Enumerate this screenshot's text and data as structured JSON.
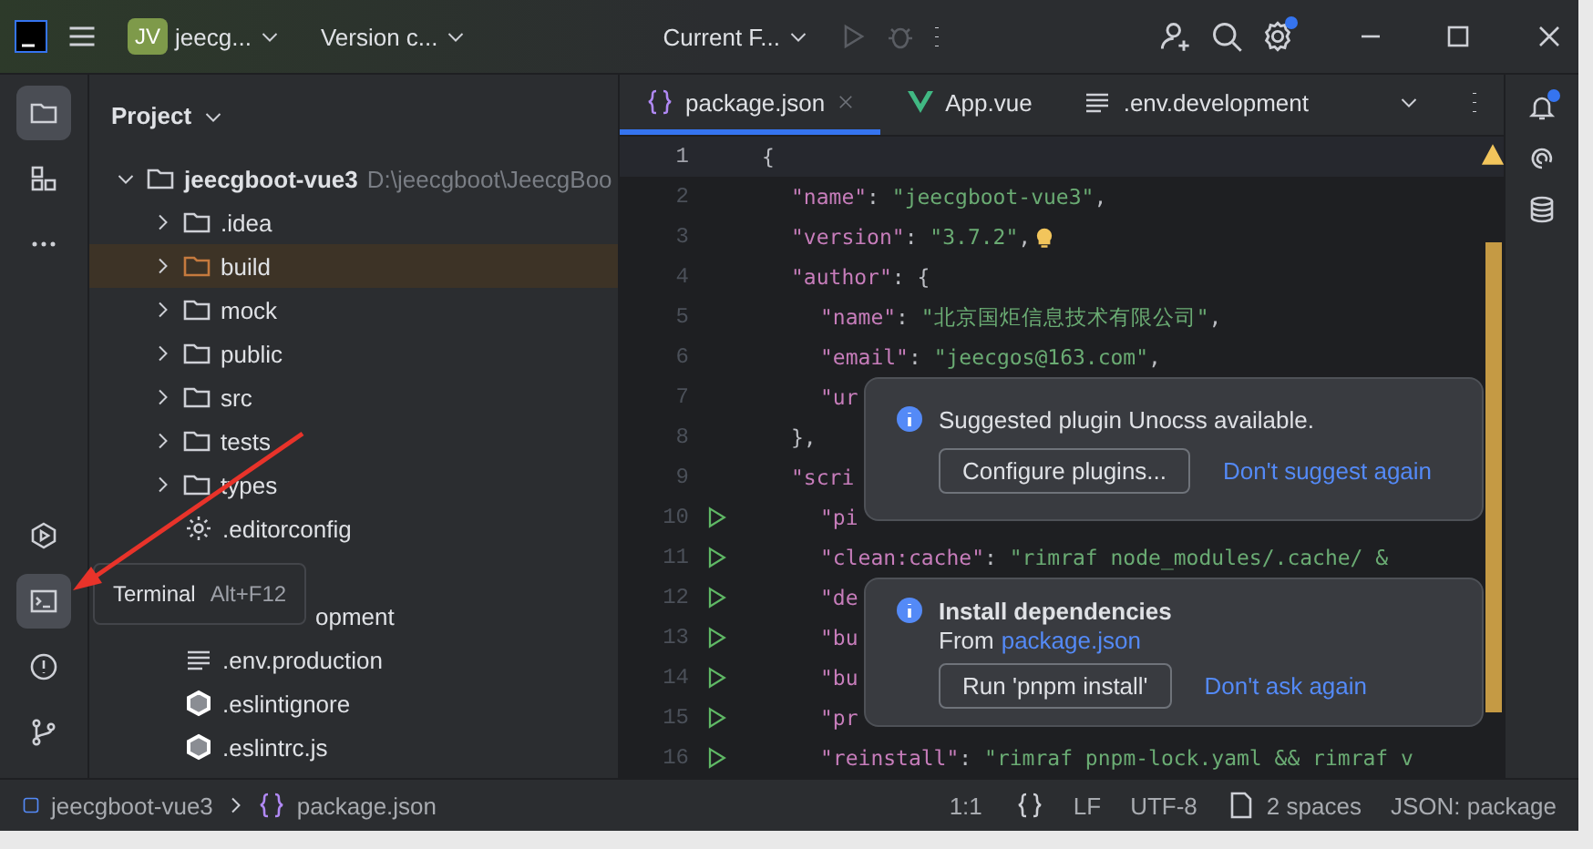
{
  "title_bar": {
    "avatar": "JV",
    "project": "jeecg...",
    "vcs": "Version c...",
    "run_config": "Current F...",
    "run_disabled": true,
    "settings_badge": true
  },
  "project_panel": {
    "title": "Project",
    "tree": {
      "name": "jeecgboot-vue3",
      "path": "D:\\jeecgboot\\JeecgBoo",
      "expanded": true,
      "children": [
        {
          "name": ".idea",
          "kind": "folder",
          "selected": false
        },
        {
          "name": "build",
          "kind": "folder",
          "selected": true
        },
        {
          "name": "mock",
          "kind": "folder",
          "selected": false
        },
        {
          "name": "public",
          "kind": "folder",
          "selected": false
        },
        {
          "name": "src",
          "kind": "folder",
          "selected": false
        },
        {
          "name": "tests",
          "kind": "folder",
          "selected": false
        },
        {
          "name": "types",
          "kind": "folder",
          "selected": false
        },
        {
          "name": ".editorconfig",
          "kind": "config",
          "selected": false
        },
        {
          "name": "opment",
          "kind": "partial",
          "selected": false
        },
        {
          "name": ".env.production",
          "kind": "text",
          "selected": false
        },
        {
          "name": ".eslintignore",
          "kind": "eslint",
          "selected": false
        },
        {
          "name": ".eslintrc.js",
          "kind": "eslint",
          "selected": false
        }
      ]
    }
  },
  "tool_strip": {
    "top": [
      {
        "kind": "folder",
        "selected": true
      },
      {
        "kind": "structure",
        "selected": false
      },
      {
        "kind": "more",
        "selected": false
      }
    ],
    "bottom": [
      {
        "kind": "run",
        "selected": false
      },
      {
        "kind": "terminal",
        "selected": true
      },
      {
        "kind": "problems",
        "selected": false
      },
      {
        "kind": "git",
        "selected": false
      }
    ]
  },
  "tooltip": {
    "label": "Terminal",
    "shortcut": "Alt+F12"
  },
  "tabs": [
    {
      "label": "package.json",
      "kind": "json",
      "selected": true
    },
    {
      "label": "App.vue",
      "kind": "vue",
      "selected": false
    },
    {
      "label": ".env.development",
      "kind": "text",
      "selected": false
    }
  ],
  "editor": {
    "lines": [
      {
        "number": "1",
        "current": true,
        "tokens": [
          {
            "kind": "punct",
            "text": "{"
          }
        ],
        "children": [
          {
            "number": "2",
            "tokens": [
              {
                "kind": "key",
                "text": "\"name\""
              },
              {
                "kind": "punct",
                "text": ": "
              },
              {
                "kind": "string",
                "text": "\"jeecgboot-vue3\""
              },
              {
                "kind": "punct",
                "text": ","
              }
            ]
          },
          {
            "number": "3",
            "bulb": true,
            "tokens": [
              {
                "kind": "key",
                "text": "\"version\""
              },
              {
                "kind": "punct",
                "text": ": "
              },
              {
                "kind": "string",
                "text": "\"3.7.2\""
              },
              {
                "kind": "punct",
                "text": ","
              }
            ]
          },
          {
            "number": "4",
            "tokens": [
              {
                "kind": "key",
                "text": "\"author\""
              },
              {
                "kind": "punct",
                "text": ": {"
              }
            ],
            "children": [
              {
                "number": "5",
                "tokens": [
                  {
                    "kind": "key",
                    "text": "\"name\""
                  },
                  {
                    "kind": "punct",
                    "text": ": "
                  },
                  {
                    "kind": "string",
                    "text": "\"北京国炬信息技术有限公司\""
                  },
                  {
                    "kind": "punct",
                    "text": ","
                  }
                ]
              },
              {
                "number": "6",
                "tokens": [
                  {
                    "kind": "key",
                    "text": "\"email\""
                  },
                  {
                    "kind": "punct",
                    "text": ": "
                  },
                  {
                    "kind": "string",
                    "text": "\"jeecgos@163.com\""
                  },
                  {
                    "kind": "punct",
                    "text": ","
                  }
                ]
              },
              {
                "number": "7",
                "tokens": [
                  {
                    "kind": "key",
                    "text": "\"ur"
                  }
                ]
              }
            ]
          },
          {
            "number": "8",
            "tokens": [
              {
                "kind": "punct",
                "text": "},"
              }
            ]
          },
          {
            "number": "9",
            "tokens": [
              {
                "kind": "key",
                "text": "\"scri"
              }
            ],
            "children": [
              {
                "number": "10",
                "runnable": true,
                "tokens": [
                  {
                    "kind": "key",
                    "text": "\"pi"
                  }
                ]
              },
              {
                "number": "11",
                "runnable": true,
                "tokens": [
                  {
                    "kind": "key",
                    "text": "\"clean:cache\""
                  },
                  {
                    "kind": "punct",
                    "text": ": "
                  },
                  {
                    "kind": "string",
                    "text": "\"rimraf node_modules/.cache/ &"
                  }
                ]
              },
              {
                "number": "12",
                "runnable": true,
                "tokens": [
                  {
                    "kind": "key",
                    "text": "\"de"
                  }
                ]
              },
              {
                "number": "13",
                "runnable": true,
                "tokens": [
                  {
                    "kind": "key",
                    "text": "\"bu"
                  }
                ]
              },
              {
                "number": "14",
                "runnable": true,
                "tokens": [
                  {
                    "kind": "key",
                    "text": "\"bu"
                  }
                ]
              },
              {
                "number": "15",
                "runnable": true,
                "tokens": [
                  {
                    "kind": "key",
                    "text": "\"pr"
                  }
                ]
              },
              {
                "number": "16",
                "runnable": true,
                "tokens": [
                  {
                    "kind": "key",
                    "text": "\"reinstall\""
                  },
                  {
                    "kind": "punct",
                    "text": ": "
                  },
                  {
                    "kind": "string",
                    "text": "\"rimraf pnpm-lock.yaml && rimraf v"
                  }
                ]
              }
            ]
          }
        ]
      }
    ]
  },
  "notifications": [
    {
      "kind": "plugin",
      "message": "Suggested plugin Unocss available.",
      "action": "Configure plugins...",
      "link": "Don't suggest again"
    },
    {
      "kind": "install",
      "title": "Install dependencies",
      "prefix": "From",
      "source": "package.json",
      "action": "Run 'pnpm install'",
      "link": "Don't ask again"
    }
  ],
  "right_strip": [
    {
      "kind": "bell",
      "badge": true
    },
    {
      "kind": "swirl",
      "badge": false
    },
    {
      "kind": "database",
      "badge": false
    }
  ],
  "status_bar": {
    "breadcrumbs": [
      {
        "kind": "project",
        "label": "jeecgboot-vue3"
      },
      {
        "kind": "json",
        "label": "package.json"
      }
    ],
    "position": "1:1",
    "line_ending": "LF",
    "encoding": "UTF-8",
    "indent": "2 spaces",
    "schema": "JSON: package"
  }
}
